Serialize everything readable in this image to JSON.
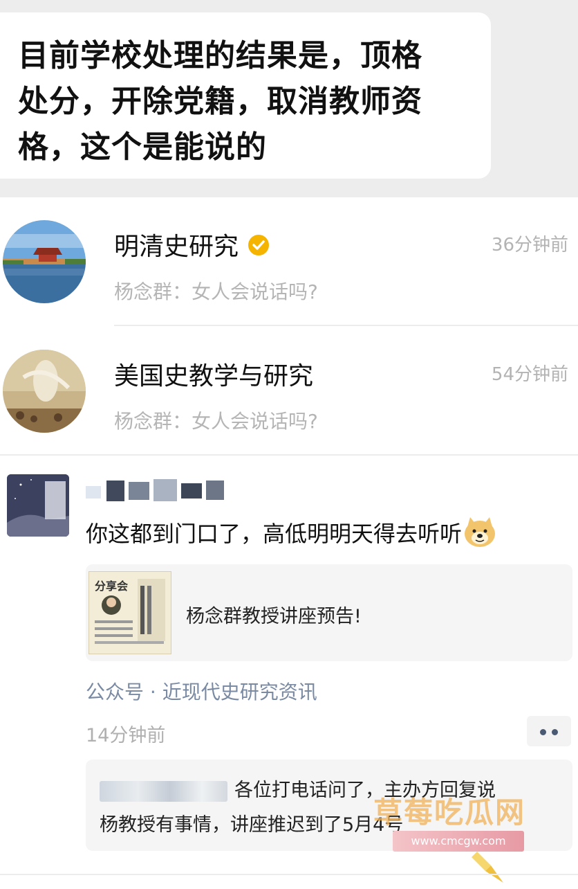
{
  "message_bubble": {
    "lines": [
      "目前学校处理的结果是，顶格",
      "处分，开除党籍，取消教师资",
      "格，这个是能说的"
    ]
  },
  "conversations": [
    {
      "title": "明清史研究",
      "time": "36分钟前",
      "preview": "杨念群：女人会说话吗?",
      "verified": true,
      "verified_color": "#f4b400",
      "avatar_icon": "forbidden-city-photo"
    },
    {
      "title": "美国史教学与研究",
      "time": "54分钟前",
      "preview": "杨念群：女人会说话吗?",
      "verified": false,
      "avatar_icon": "painting-avatar"
    }
  ],
  "comment": {
    "text": "你这都到门口了，高低明明天得去听听",
    "emoji": "doge-emoji",
    "card": {
      "title": "杨念群教授讲座预告!",
      "thumb_header": "分享会"
    },
    "source": "公众号 · 近现代史研究资讯",
    "time": "14分钟前",
    "more_icon": "more-dots-icon",
    "reply": {
      "line1": "各位打电话问了，主办方回复说",
      "line2": "杨教授有事情，讲座推迟到了5月4号"
    }
  },
  "watermark": {
    "text": "草莓吃瓜网",
    "url": "www.cmcgw.com"
  },
  "colors": {
    "accent_link": "#7a8aa3",
    "watermark": "#f0b25a"
  }
}
